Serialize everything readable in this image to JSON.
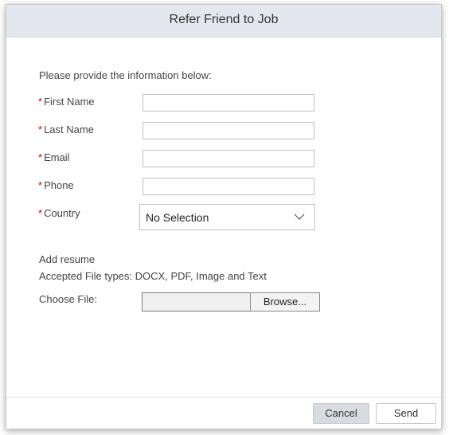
{
  "dialog": {
    "title": "Refer Friend to Job"
  },
  "form": {
    "intro": "Please provide the information below:",
    "required_marker": "*",
    "fields": {
      "first_name": {
        "label": "First Name",
        "value": ""
      },
      "last_name": {
        "label": "Last Name",
        "value": ""
      },
      "email": {
        "label": "Email",
        "value": ""
      },
      "phone": {
        "label": "Phone",
        "value": ""
      },
      "country": {
        "label": "Country",
        "selected": "No Selection"
      }
    }
  },
  "resume": {
    "title": "Add resume",
    "file_types": "Accepted File types: DOCX, PDF, Image and Text",
    "choose_label": "Choose File:",
    "browse_label": "Browse..."
  },
  "footer": {
    "cancel_label": "Cancel",
    "send_label": "Send"
  },
  "colors": {
    "required": "#cc0000",
    "header_bg": "#e4e8ee",
    "cancel_bg": "#d8dce1"
  },
  "icons": {
    "country_dropdown": "chevron-down-icon"
  }
}
